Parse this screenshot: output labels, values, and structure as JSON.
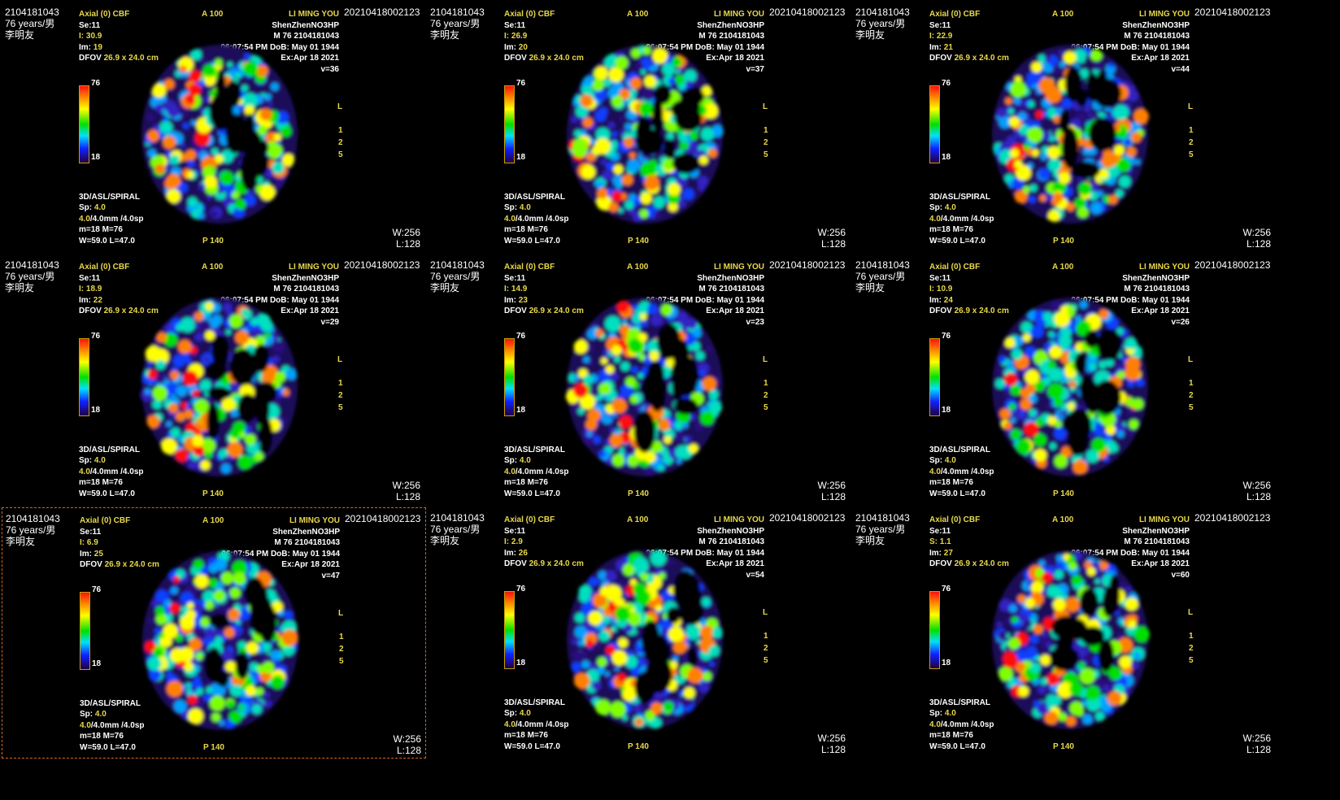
{
  "patient": {
    "id": "2104181043",
    "age_sex": "76 years/男",
    "name_cn": "李明友",
    "accession": "20210418002123",
    "name_en": "LI MING YOU",
    "institution": "ShenZhenNO3HP",
    "sex_age_id": "M 76 2104181043",
    "time_dob": "06:07:54 PM DoB: May 01 1944",
    "exam_date": "Ex:Apr 18 2021"
  },
  "series": {
    "title": "Axial (0) CBF",
    "anterior": "A 100",
    "posterior": "P 140",
    "se": "Se:11",
    "dfov_label": "DFOV",
    "dfov_value": "26.9 x 24.0 cm",
    "sequence": "3D/ASL/SPIRAL",
    "sp_label": "Sp:",
    "sp_value": "4.0",
    "thick_value": "4.0",
    "thick_rest": "/4.0mm /4.0sp",
    "mM": "m=18 M=76",
    "WL": "W=59.0 L=47.0",
    "scale_max": "76",
    "scale_min": "18",
    "side": "L",
    "marks": [
      "1",
      "2",
      "5"
    ],
    "window": "W:256",
    "level": "L:128"
  },
  "images": [
    {
      "loc_label": "I:",
      "loc": "30.9",
      "im": "19",
      "v": "v=36",
      "selected": false
    },
    {
      "loc_label": "I:",
      "loc": "26.9",
      "im": "20",
      "v": "v=37",
      "selected": false
    },
    {
      "loc_label": "I:",
      "loc": "22.9",
      "im": "21",
      "v": "v=44",
      "selected": false
    },
    {
      "loc_label": "I:",
      "loc": "18.9",
      "im": "22",
      "v": "v=29",
      "selected": false
    },
    {
      "loc_label": "I:",
      "loc": "14.9",
      "im": "23",
      "v": "v=23",
      "selected": false
    },
    {
      "loc_label": "I:",
      "loc": "10.9",
      "im": "24",
      "v": "v=26",
      "selected": false
    },
    {
      "loc_label": "I:",
      "loc": "6.9",
      "im": "25",
      "v": "v=47",
      "selected": true
    },
    {
      "loc_label": "I:",
      "loc": "2.9",
      "im": "26",
      "v": "v=54",
      "selected": false
    },
    {
      "loc_label": "S:",
      "loc": "1.1",
      "im": "27",
      "v": "v=60",
      "selected": false
    }
  ],
  "colors": {
    "overlay_yellow": "#e8d84a",
    "overlay_white": "#ffffff",
    "selection_border": "#d2691e"
  }
}
